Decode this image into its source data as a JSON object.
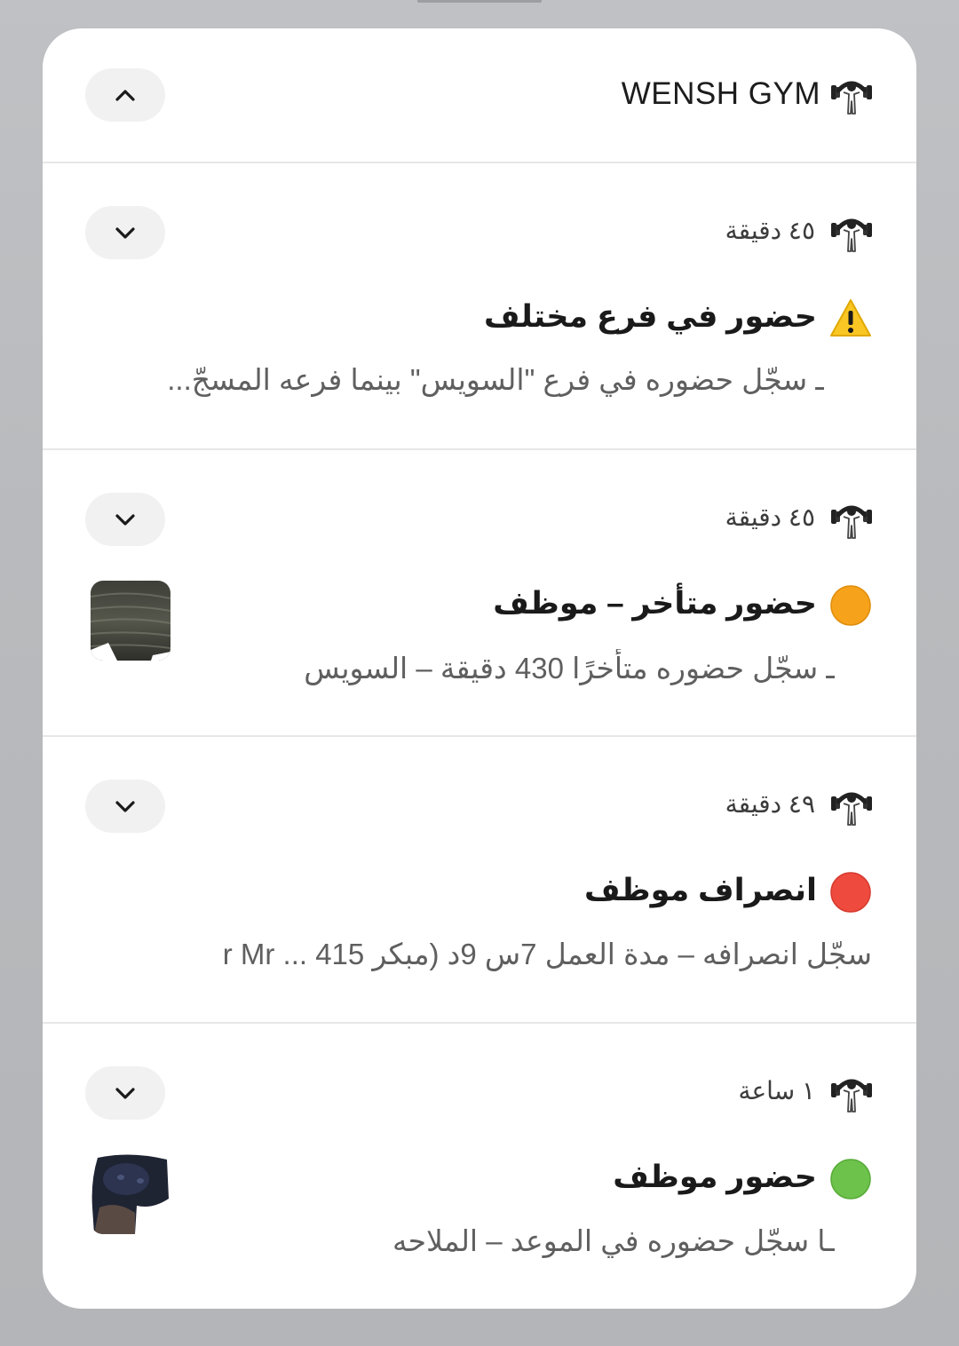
{
  "header": {
    "app_name": "WENSH GYM",
    "collapse_icon": "chevron-up-icon",
    "app_icon": "dumbbell-person-icon"
  },
  "notifications": [
    {
      "time": "٤٥ دقيقة",
      "status_icon": "warning-icon",
      "title": "حضور في فرع مختلف",
      "body": "ـ سجّل حضوره في فرع \"السويس\" بينما فرعه المسجّ...",
      "expand_icon": "chevron-down-icon"
    },
    {
      "time": "٤٥ دقيقة",
      "status_icon": "orange-circle-icon",
      "title": "حضور متأخر – موظف",
      "body": "ـ سجّل حضوره متأخرًا 430 دقيقة – السويس",
      "expand_icon": "chevron-down-icon",
      "thumbnail": "employee-photo"
    },
    {
      "time": "٤٩ دقيقة",
      "status_icon": "red-circle-icon",
      "title": "انصراف موظف",
      "body": "سجّل انصرافه – مدة العمل 7س 9د (مبكر 415 ... r    Mr",
      "expand_icon": "chevron-down-icon"
    },
    {
      "time": "١ ساعة",
      "status_icon": "green-circle-icon",
      "title": "حضور موظف",
      "body": "ـا سجّل حضوره في الموعد – الملاحه",
      "expand_icon": "chevron-down-icon",
      "thumbnail": "employee-photo"
    }
  ],
  "colors": {
    "panel_bg": "#ffffff",
    "pill_bg": "#f1f1f2",
    "divider": "#e7e7e7",
    "title_text": "#1a1a1a",
    "body_text": "#5f5f5f",
    "orange": "#f7a21b",
    "red": "#ee4b3e",
    "green": "#6cc24a",
    "warning_yellow": "#f9c623"
  }
}
